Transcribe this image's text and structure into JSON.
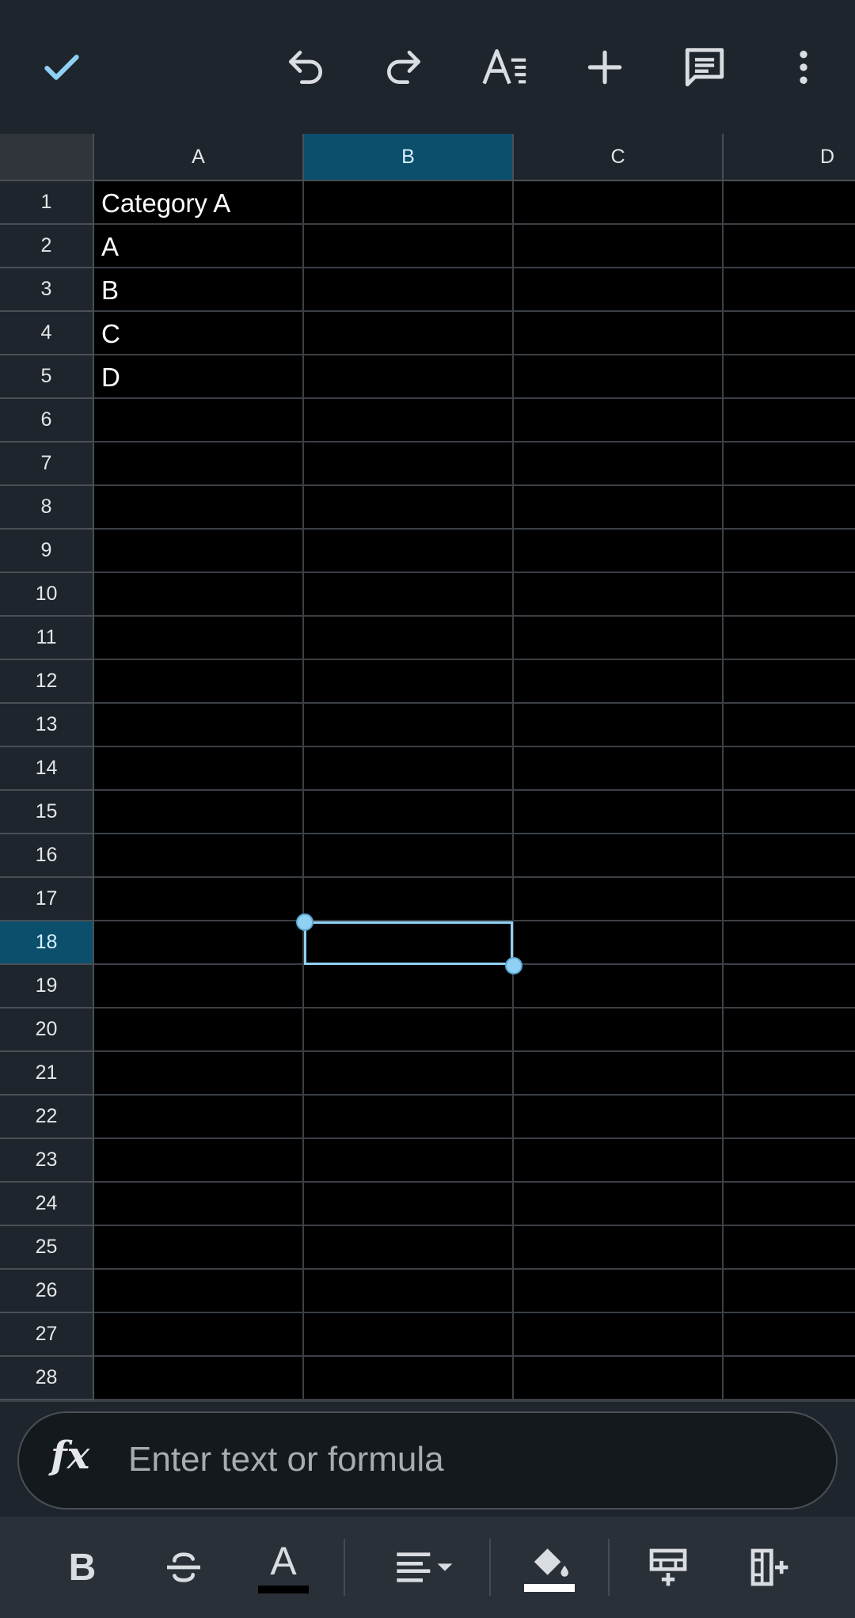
{
  "toolbar": {
    "done": "check-icon",
    "undo": "undo-icon",
    "redo": "redo-icon",
    "text_format": "text-format-icon",
    "insert": "plus-icon",
    "comment": "comment-icon",
    "more": "more-vert-icon"
  },
  "columns": [
    "A",
    "B",
    "C",
    "D"
  ],
  "selected_column": "B",
  "rows": [
    "1",
    "2",
    "3",
    "4",
    "5",
    "6",
    "7",
    "8",
    "9",
    "10",
    "11",
    "12",
    "13",
    "14",
    "15",
    "16",
    "17",
    "18",
    "19",
    "20",
    "21",
    "22",
    "23",
    "24",
    "25",
    "26",
    "27",
    "28"
  ],
  "selected_row": "18",
  "cells": {
    "A1": "Category A",
    "A2": "A",
    "A3": "B",
    "A4": "C",
    "A5": "D"
  },
  "formula_bar": {
    "fx_label": "fx",
    "placeholder": "Enter text or formula"
  },
  "format_bar": {
    "bold_label": "B",
    "text_color_label": "A"
  },
  "colors": {
    "accent": "#8fd0f3",
    "selected_header": "#0b4f6c",
    "toolbar_bg": "#1f252c"
  }
}
